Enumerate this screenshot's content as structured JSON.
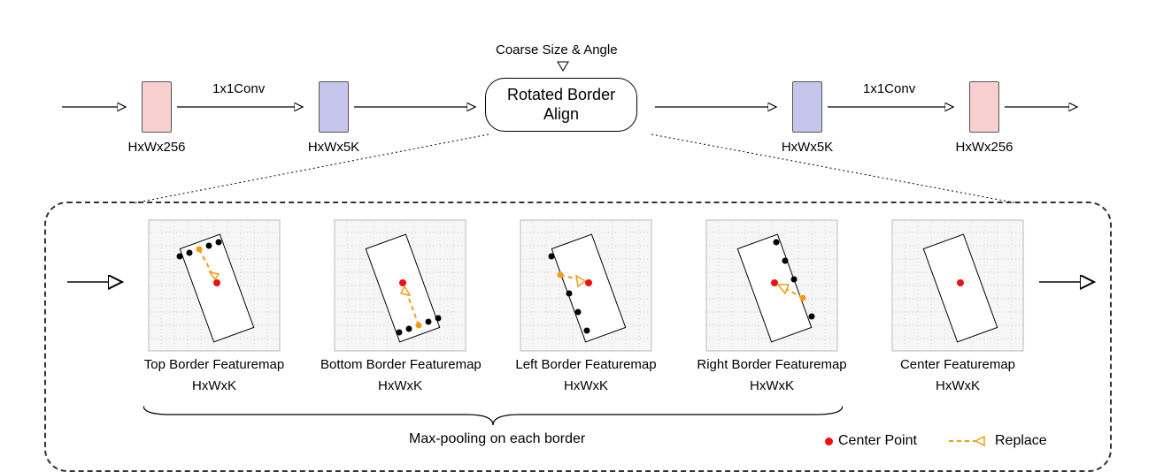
{
  "pipeline": {
    "top_annot": "Coarse Size & Angle",
    "conv1": "1x1Conv",
    "conv2": "1x1Conv",
    "rba_line1": "Rotated Border",
    "rba_line2": "Align",
    "b1": "HxWx256",
    "b2": "HxWx5K",
    "b3": "HxWx5K",
    "b4": "HxWx256"
  },
  "tiles": {
    "t1": {
      "title": "Top Border Featuremap",
      "dim": "HxWxK"
    },
    "t2": {
      "title": "Bottom Border Featuremap",
      "dim": "HxWxK"
    },
    "t3": {
      "title": "Left Border Featuremap",
      "dim": "HxWxK"
    },
    "t4": {
      "title": "Right Border Featuremap",
      "dim": "HxWxK"
    },
    "t5": {
      "title": "Center Featuremap",
      "dim": "HxWxK"
    }
  },
  "maxpool": "Max-pooling on each border",
  "legend": {
    "center": "Center Point",
    "replace": "Replace"
  },
  "colors": {
    "pink": "#f7cfce",
    "blue": "#c6c6ec",
    "orange": "#f39c12",
    "red": "#e11"
  }
}
